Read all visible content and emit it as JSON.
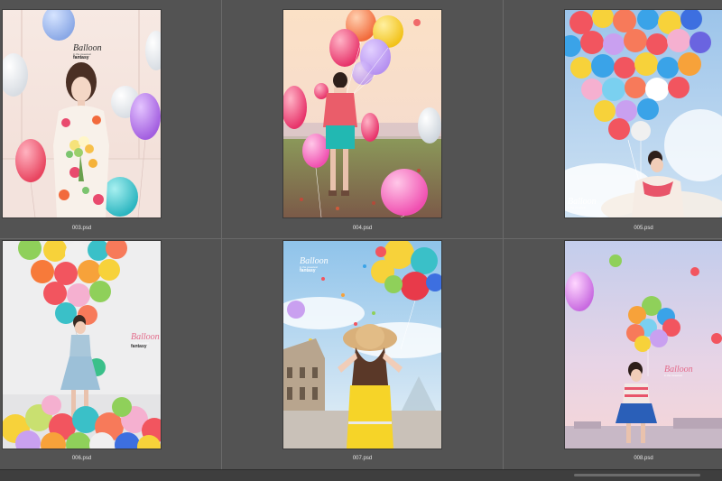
{
  "brand": {
    "title": "Balloon",
    "tagline": "in the sweetest",
    "word": "fantasy"
  },
  "thumbnails": [
    {
      "filename": "003.psd"
    },
    {
      "filename": "004.psd"
    },
    {
      "filename": "005.psd"
    },
    {
      "filename": "006.psd"
    },
    {
      "filename": "007.psd"
    },
    {
      "filename": "008.psd"
    }
  ]
}
